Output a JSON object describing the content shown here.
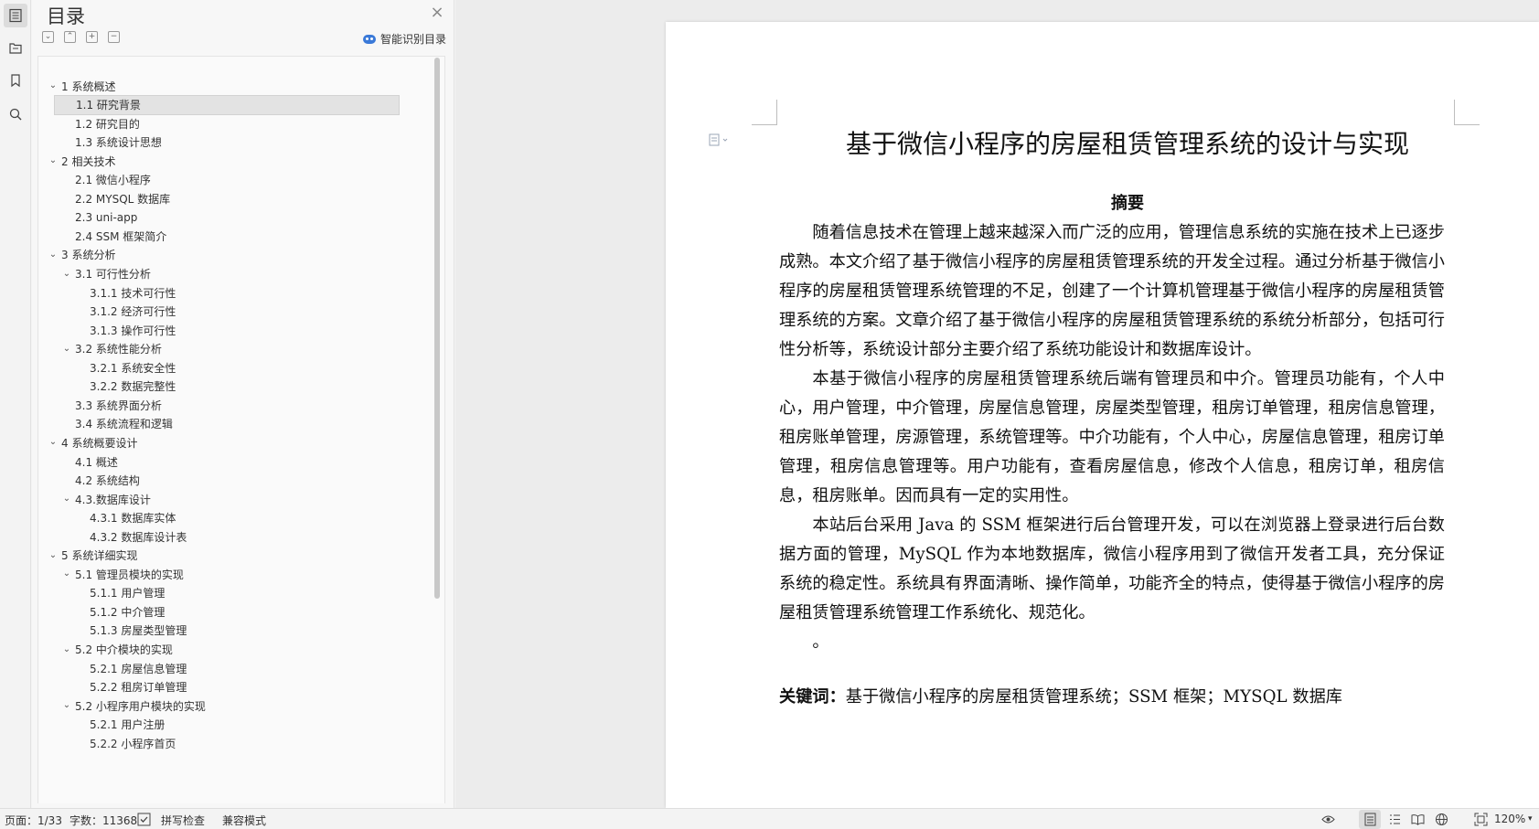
{
  "rail": {
    "icons": [
      "toc-icon",
      "navigation-icon",
      "bookmark-icon",
      "search-icon"
    ]
  },
  "toc": {
    "title": "目录",
    "close": "×",
    "smart_label": "智能识别目录",
    "items": [
      {
        "label": "1 系统概述",
        "level": 0,
        "expanded": true
      },
      {
        "label": "1.1  研究背景",
        "level": 1,
        "selected": true
      },
      {
        "label": "1.2 研究目的",
        "level": 1
      },
      {
        "label": "1.3 系统设计思想",
        "level": 1
      },
      {
        "label": "2 相关技术",
        "level": 0,
        "expanded": true
      },
      {
        "label": "2.1 微信小程序",
        "level": 1
      },
      {
        "label": "2.2 MYSQL 数据库",
        "level": 1
      },
      {
        "label": "2.3 uni-app",
        "level": 1
      },
      {
        "label": "2.4 SSM 框架简介",
        "level": 1
      },
      {
        "label": "3 系统分析",
        "level": 0,
        "expanded": true
      },
      {
        "label": "3.1 可行性分析",
        "level": 1,
        "expanded": true
      },
      {
        "label": "3.1.1 技术可行性",
        "level": 2
      },
      {
        "label": "3.1.2 经济可行性",
        "level": 2
      },
      {
        "label": "3.1.3 操作可行性",
        "level": 2
      },
      {
        "label": "3.2 系统性能分析",
        "level": 1,
        "expanded": true
      },
      {
        "label": "3.2.1  系统安全性",
        "level": 2
      },
      {
        "label": "3.2.2  数据完整性",
        "level": 2
      },
      {
        "label": "3.3 系统界面分析",
        "level": 1
      },
      {
        "label": "3.4 系统流程和逻辑",
        "level": 1
      },
      {
        "label": "4 系统概要设计",
        "level": 0,
        "expanded": true
      },
      {
        "label": "4.1 概述",
        "level": 1
      },
      {
        "label": "4.2 系统结构",
        "level": 1
      },
      {
        "label": "4.3.数据库设计",
        "level": 1,
        "expanded": true
      },
      {
        "label": "4.3.1 数据库实体",
        "level": 2
      },
      {
        "label": "4.3.2 数据库设计表",
        "level": 2
      },
      {
        "label": "5 系统详细实现",
        "level": 0,
        "expanded": true
      },
      {
        "label": "5.1  管理员模块的实现",
        "level": 1,
        "expanded": true
      },
      {
        "label": "5.1.1  用户管理",
        "level": 2
      },
      {
        "label": "5.1.2  中介管理",
        "level": 2
      },
      {
        "label": "5.1.3  房屋类型管理",
        "level": 2
      },
      {
        "label": "5.2  中介模块的实现",
        "level": 1,
        "expanded": true
      },
      {
        "label": "5.2.1  房屋信息管理",
        "level": 2
      },
      {
        "label": "5.2.2  租房订单管理",
        "level": 2
      },
      {
        "label": "5.2  小程序用户模块的实现",
        "level": 1,
        "expanded": true
      },
      {
        "label": "5.2.1  用户注册",
        "level": 2
      },
      {
        "label": "5.2.2  小程序首页",
        "level": 2
      }
    ]
  },
  "document": {
    "title": "基于微信小程序的房屋租赁管理系统的设计与实现",
    "subhead": "摘要",
    "paragraphs": [
      "随着信息技术在管理上越来越深入而广泛的应用，管理信息系统的实施在技术上已逐步成熟。本文介绍了基于微信小程序的房屋租赁管理系统的开发全过程。通过分析基于微信小程序的房屋租赁管理系统管理的不足，创建了一个计算机管理基于微信小程序的房屋租赁管理系统的方案。文章介绍了基于微信小程序的房屋租赁管理系统的系统分析部分，包括可行性分析等，系统设计部分主要介绍了系统功能设计和数据库设计。",
      "本基于微信小程序的房屋租赁管理系统后端有管理员和中介。管理员功能有，个人中心，用户管理，中介管理，房屋信息管理，房屋类型管理，租房订单管理，租房信息管理，租房账单管理，房源管理，系统管理等。中介功能有，个人中心，房屋信息管理，租房订单管理，租房信息管理等。用户功能有，查看房屋信息，修改个人信息，租房订单，租房信息，租房账单。因而具有一定的实用性。",
      "本站后台采用 Java 的 SSM 框架进行后台管理开发，可以在浏览器上登录进行后台数据方面的管理，MySQL 作为本地数据库，微信小程序用到了微信开发者工具，充分保证系统的稳定性。系统具有界面清晰、操作简单，功能齐全的特点，使得基于微信小程序的房屋租赁管理系统管理工作系统化、规范化。"
    ],
    "trailing_mark": "。",
    "keywords_label": "关键词：",
    "keywords_text": "基于微信小程序的房屋租赁管理系统；SSM 框架；MYSQL 数据库"
  },
  "status": {
    "page": "页面：1/33",
    "words": "字数：11368",
    "spellcheck": "拼写检查",
    "compat": "兼容模式",
    "zoom": "120%"
  }
}
